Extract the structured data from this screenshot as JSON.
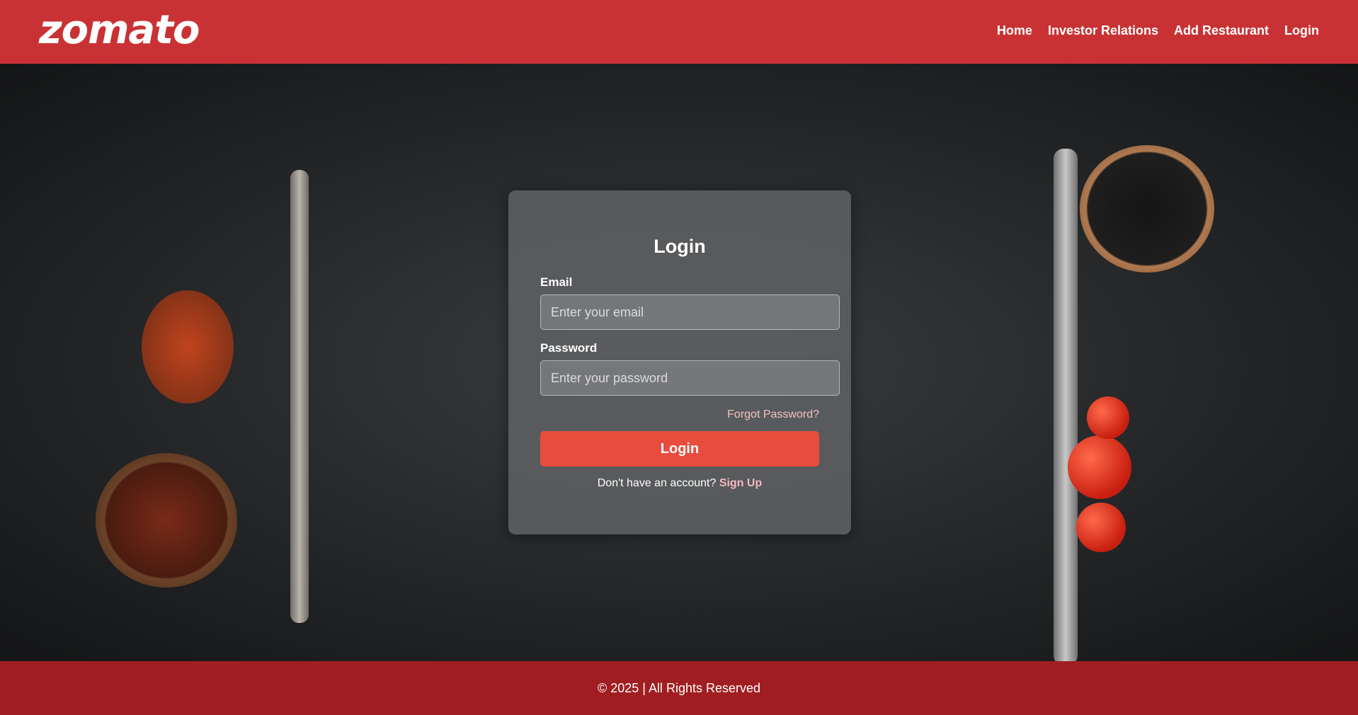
{
  "header": {
    "logo": "zomato",
    "nav": [
      "Home",
      "Investor Relations",
      "Add Restaurant",
      "Login"
    ]
  },
  "login": {
    "title": "Login",
    "email_label": "Email",
    "email_placeholder": "Enter your email",
    "password_label": "Password",
    "password_placeholder": "Enter your password",
    "forgot": "Forgot Password?",
    "button": "Login",
    "signup_prompt": "Don't have an account?",
    "signup_link": "Sign Up"
  },
  "footer": {
    "text": "© 2025 | All Rights Reserved"
  },
  "colors": {
    "header": "#c93234",
    "button": "#e74c3c",
    "footer": "#a01e21"
  }
}
